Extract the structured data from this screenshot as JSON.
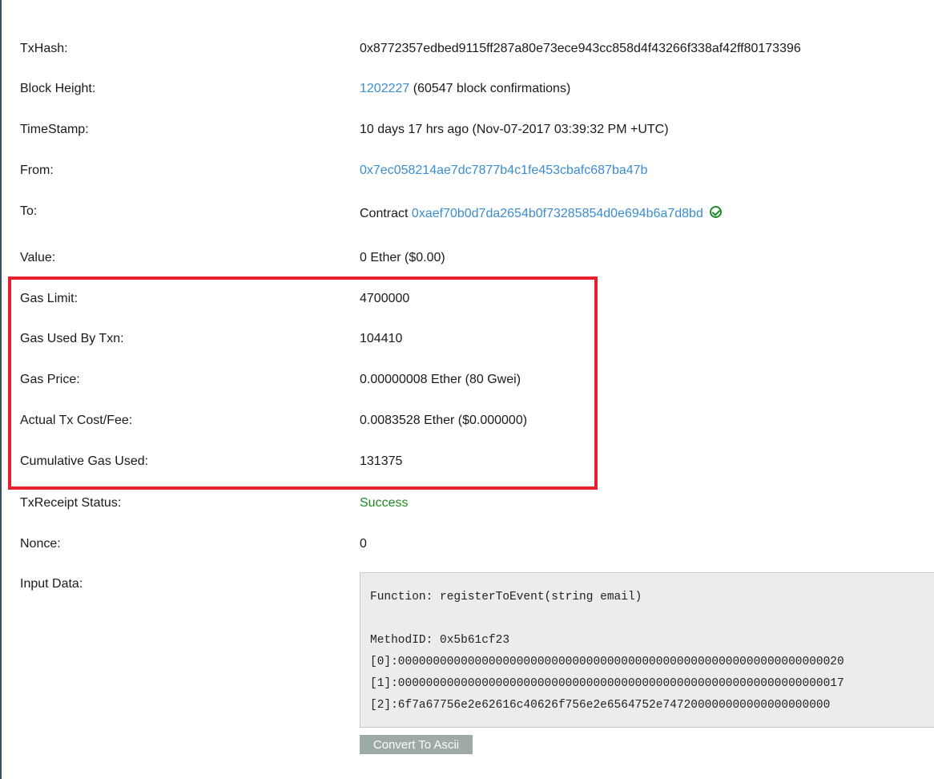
{
  "rows": {
    "txhash": {
      "label": "TxHash:",
      "value": "0x8772357edbed9115ff287a80e73ece943cc858d4f43266f338af42ff80173396"
    },
    "block_height": {
      "label": "Block Height:",
      "link": "1202227",
      "suffix": " (60547 block confirmations)"
    },
    "timestamp": {
      "label": "TimeStamp:",
      "value": "10 days 17 hrs ago (Nov-07-2017 03:39:32 PM +UTC)"
    },
    "from": {
      "label": "From:",
      "link": "0x7ec058214ae7dc7877b4c1fe453cbafc687ba47b"
    },
    "to": {
      "label": "To:",
      "prefix": "Contract ",
      "link": "0xaef70b0d7da2654b0f73285854d0e694b6a7d8bd"
    },
    "value": {
      "label": "Value:",
      "value": "0 Ether ($0.00)"
    },
    "gas_limit": {
      "label": "Gas Limit:",
      "value": "4700000"
    },
    "gas_used": {
      "label": "Gas Used By Txn:",
      "value": "104410"
    },
    "gas_price": {
      "label": "Gas Price:",
      "value": "0.00000008 Ether (80 Gwei)"
    },
    "tx_cost": {
      "label": "Actual Tx Cost/Fee:",
      "value": "0.0083528 Ether ($0.000000)"
    },
    "cumulative_gas": {
      "label": "Cumulative Gas Used:",
      "value": "131375"
    },
    "receipt_status": {
      "label": "TxReceipt Status:",
      "value": "Success"
    },
    "nonce": {
      "label": "Nonce:",
      "value": "0"
    },
    "input_data": {
      "label": "Input Data:"
    }
  },
  "input_data": {
    "function": "Function: registerToEvent(string email)",
    "method_id": "MethodID: 0x5b61cf23",
    "params": [
      "[0]:0000000000000000000000000000000000000000000000000000000000000020",
      "[1]:0000000000000000000000000000000000000000000000000000000000000017",
      "[2]:6f7a67756e2e62616c40626f756e2e6564752e747200000000000000000000"
    ]
  },
  "convert_button": "Convert To Ascii",
  "colors": {
    "link": "#3b8dd0",
    "success": "#1e8a24",
    "highlight": "#e8202e",
    "button": "#9eaaa5"
  }
}
